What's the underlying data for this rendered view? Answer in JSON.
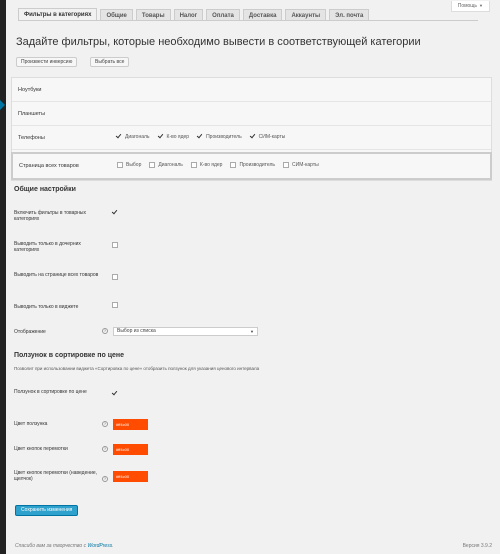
{
  "help": {
    "label": "Помощь"
  },
  "tabs": [
    {
      "label": "Фильтры в категориях"
    },
    {
      "label": "Общие"
    },
    {
      "label": "Товары"
    },
    {
      "label": "Налог"
    },
    {
      "label": "Оплата"
    },
    {
      "label": "Доставка"
    },
    {
      "label": "Аккаунты"
    },
    {
      "label": "Эл. почта"
    }
  ],
  "page_title": "Задайте фильтры, которые необходимо вывести в соответствующей категории",
  "buttons": {
    "invert": "Произвести инверсию",
    "select_all": "Выбрать все"
  },
  "categories": [
    {
      "name": "Ноутбуки"
    },
    {
      "name": "Планшеты"
    },
    {
      "name": "Телефоны",
      "filters": [
        {
          "label": "Диагональ",
          "checked": true
        },
        {
          "label": "К-во ядер",
          "checked": true
        },
        {
          "label": "Производитель",
          "checked": true
        },
        {
          "label": "СИМ-карты",
          "checked": true
        }
      ]
    },
    {
      "name": "Страница всех товаров",
      "filters": [
        {
          "label": "Выбор",
          "checked": false
        },
        {
          "label": "Диагональ",
          "checked": false
        },
        {
          "label": "К-во ядер",
          "checked": false
        },
        {
          "label": "Производитель",
          "checked": false
        },
        {
          "label": "СИМ-карты",
          "checked": false
        }
      ]
    }
  ],
  "general": {
    "heading": "Общие настройки",
    "enable_filters": {
      "label": "Включить фильтры в товарных категориях",
      "checked": true
    },
    "only_child": {
      "label": "Выводить только в дочерних категориях",
      "checked": false
    },
    "all_products": {
      "label": "Выводить на странице всех товаров",
      "checked": false
    },
    "only_widget": {
      "label": "Выводить только в виджете",
      "checked": false
    },
    "display": {
      "label": "Отображение",
      "value": "Выбор из списка"
    }
  },
  "slider": {
    "heading": "Ползунок в сортировке по цене",
    "description": "Позволит при использовании виджета «Сортировка по цене» отобразить ползунок для указания ценового интервала",
    "enable": {
      "label": "Ползунок в сортировке по цене",
      "checked": true
    },
    "color_slider": {
      "label": "Цвет ползунка",
      "value": "#ff4c00"
    },
    "color_buttons": {
      "label": "Цвет кнопок перемотки",
      "value": "#ff4c00"
    },
    "color_buttons_hover": {
      "label": "Цвет кнопок перемотки (наведение, щелчок)",
      "value": "#ff4c00"
    }
  },
  "save_label": "Сохранить изменения",
  "footer": {
    "prefix": "Спасибо вам за творчество с",
    "link": "WordPress",
    "suffix": ".",
    "version": "Версия 3.9.2"
  },
  "colors": {
    "accent": "#ff4c00",
    "primary": "#2ea2cc"
  }
}
